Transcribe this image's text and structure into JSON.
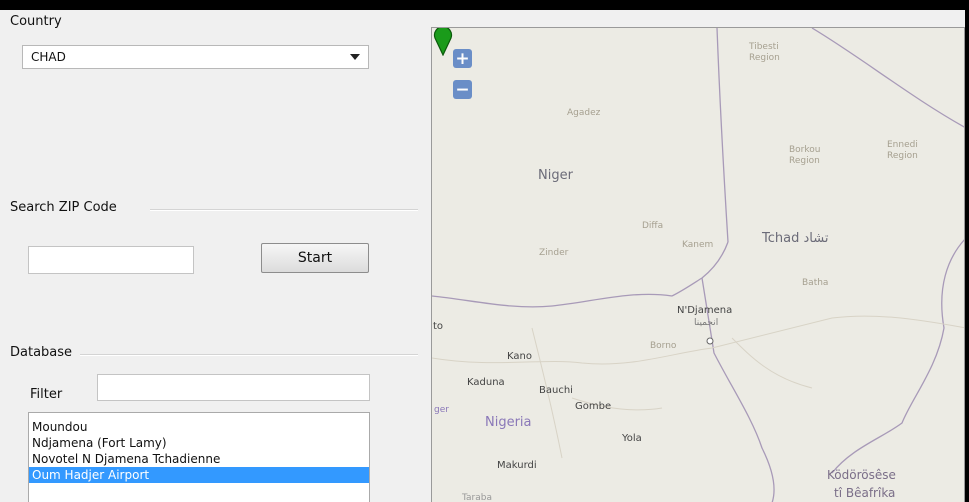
{
  "country": {
    "label": "Country",
    "selected": "CHAD"
  },
  "zip": {
    "label": "Search ZIP Code",
    "input_value": "",
    "start_label": "Start"
  },
  "database": {
    "label": "Database",
    "filter_label": "Filter",
    "filter_value": "",
    "items": [
      "Moundou",
      "Ndjamena (Fort Lamy)",
      "Novotel N Djamena Tchadienne",
      "Oum Hadjer Airport"
    ],
    "selected_index": 3
  },
  "map": {
    "zoom_in": "+",
    "zoom_out": "−",
    "labels": {
      "niger": "Niger",
      "tchad": "Tchad تشاد",
      "nigeria": "Nigeria",
      "ndjamena": "N'Djamena",
      "ndjamena_ar": "انجمينا",
      "kano": "Kano",
      "kaduna": "Kaduna",
      "bauchi": "Bauchi",
      "gombe": "Gombe",
      "yola": "Yola",
      "makurdi": "Makurdi",
      "kodorosese": "Ködörösêse",
      "beafrika": "tî Bêafrîka",
      "agadez": "Agadez",
      "zinder": "Zinder",
      "diffa": "Diffa",
      "kanem": "Kanem",
      "batha": "Batha",
      "borno": "Borno",
      "tibesti": "Tibesti Region",
      "borkou": "Borkou Region",
      "ennedi": "Ennedi Region",
      "to": "to",
      "ger": "ger",
      "taraba": "Taraba"
    }
  }
}
